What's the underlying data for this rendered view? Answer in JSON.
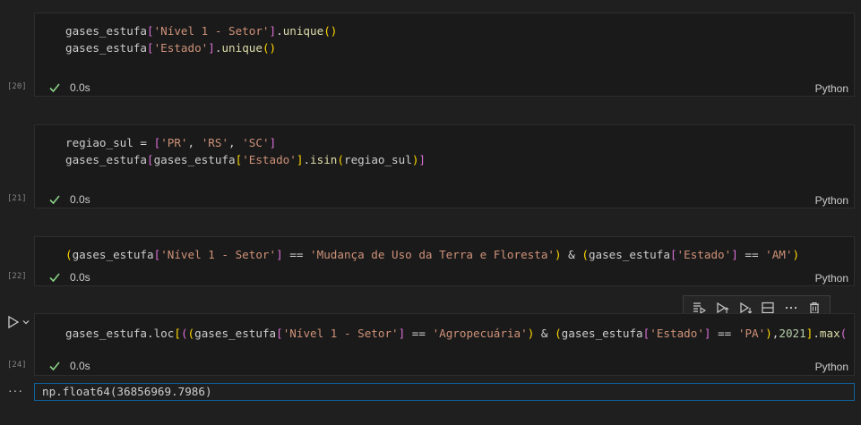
{
  "cells": [
    {
      "exec_count": "[20]",
      "time": "0.0s",
      "language": "Python",
      "lines": [
        [
          [
            "gases_estufa",
            ""
          ],
          [
            "[",
            "brk"
          ],
          [
            "'Nível 1 - Setor'",
            "str"
          ],
          [
            "]",
            "brk"
          ],
          [
            ".",
            "op"
          ],
          [
            "unique",
            "fn"
          ],
          [
            "()",
            "brk2"
          ]
        ],
        [
          [
            "gases_estufa",
            ""
          ],
          [
            "[",
            "brk"
          ],
          [
            "'Estado'",
            "str"
          ],
          [
            "]",
            "brk"
          ],
          [
            ".",
            "op"
          ],
          [
            "unique",
            "fn"
          ],
          [
            "()",
            "brk2"
          ]
        ]
      ]
    },
    {
      "exec_count": "[21]",
      "time": "0.0s",
      "language": "Python",
      "lines": [
        [
          [
            "regiao_sul ",
            ""
          ],
          [
            "=",
            "op"
          ],
          [
            " ",
            ""
          ],
          [
            "[",
            "brk"
          ],
          [
            "'PR'",
            "str"
          ],
          [
            ", ",
            ""
          ],
          [
            "'RS'",
            "str"
          ],
          [
            ", ",
            ""
          ],
          [
            "'SC'",
            "str"
          ],
          [
            "]",
            "brk"
          ]
        ],
        [
          [
            "gases_estufa",
            ""
          ],
          [
            "[",
            "brk"
          ],
          [
            "gases_estufa",
            ""
          ],
          [
            "[",
            "brk2"
          ],
          [
            "'Estado'",
            "str"
          ],
          [
            "]",
            "brk2"
          ],
          [
            ".",
            "op"
          ],
          [
            "isin",
            "fn"
          ],
          [
            "(",
            "brk2"
          ],
          [
            "regiao_sul",
            ""
          ],
          [
            ")",
            "brk2"
          ],
          [
            "]",
            "brk"
          ]
        ]
      ]
    },
    {
      "exec_count": "[22]",
      "time": "0.0s",
      "language": "Python",
      "lines": [
        [
          [
            "(",
            "brk2"
          ],
          [
            "gases_estufa",
            ""
          ],
          [
            "[",
            "brk"
          ],
          [
            "'Nível 1 - Setor'",
            "str"
          ],
          [
            "]",
            "brk"
          ],
          [
            " == ",
            "op"
          ],
          [
            "'Mudança de Uso da Terra e Floresta'",
            "str"
          ],
          [
            ")",
            "brk2"
          ],
          [
            " & ",
            "op"
          ],
          [
            "(",
            "brk2"
          ],
          [
            "gases_estufa",
            ""
          ],
          [
            "[",
            "brk"
          ],
          [
            "'Estado'",
            "str"
          ],
          [
            "]",
            "brk"
          ],
          [
            " == ",
            "op"
          ],
          [
            "'AM'",
            "str"
          ],
          [
            ")",
            "brk2"
          ]
        ]
      ]
    },
    {
      "exec_count": "[24]",
      "time": "0.0s",
      "language": "Python",
      "lines": [
        [
          [
            "gases_estufa",
            ""
          ],
          [
            ".",
            "op"
          ],
          [
            "loc",
            ""
          ],
          [
            "[",
            "brk2"
          ],
          [
            "(",
            "brk"
          ],
          [
            "(",
            "brk2"
          ],
          [
            "gases_estufa",
            ""
          ],
          [
            "[",
            "brk"
          ],
          [
            "'Nível 1 - Setor'",
            "str"
          ],
          [
            "]",
            "brk"
          ],
          [
            " == ",
            "op"
          ],
          [
            "'Agropecuária'",
            "str"
          ],
          [
            ")",
            "brk2"
          ],
          [
            " & ",
            "op"
          ],
          [
            "(",
            "brk2"
          ],
          [
            "gases_estufa",
            ""
          ],
          [
            "[",
            "brk"
          ],
          [
            "'Estado'",
            "str"
          ],
          [
            "]",
            "brk"
          ],
          [
            " == ",
            "op"
          ],
          [
            "'PA'",
            "str"
          ],
          [
            ")",
            "brk2"
          ],
          [
            ",",
            "op"
          ],
          [
            "2021",
            "num"
          ],
          [
            "]",
            "brk2"
          ],
          [
            ".",
            "op"
          ],
          [
            "max",
            "fn"
          ],
          [
            "(",
            "brk"
          ]
        ]
      ]
    }
  ],
  "output": {
    "text": "np.float64(36856969.7986)"
  },
  "toolbar": {
    "items": [
      "execute-above-icon",
      "execute-cell-and-above-icon",
      "execute-cell-and-below-icon",
      "split-cell-icon",
      "more-actions-icon",
      "delete-icon"
    ]
  },
  "colors": {
    "str": "#ce9178",
    "fn": "#dcdcaa",
    "check": "#89d185",
    "accent": "#0e639c"
  }
}
